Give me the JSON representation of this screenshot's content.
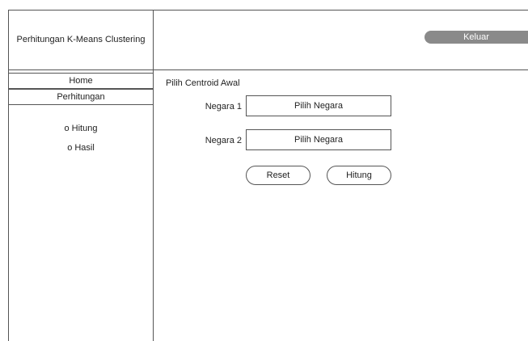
{
  "header": {
    "app_title": "Perhitungan K-Means Clustering",
    "logout_label": "Keluar"
  },
  "sidebar": {
    "items": [
      {
        "label": "Home"
      },
      {
        "label": "Perhitungan"
      }
    ],
    "sub_items": [
      {
        "label": "o Hitung"
      },
      {
        "label": "o Hasil"
      }
    ]
  },
  "main": {
    "section_title": "Pilih Centroid Awal",
    "fields": [
      {
        "label": "Negara 1",
        "value": "Pilih Negara"
      },
      {
        "label": "Negara 2",
        "value": "Pilih Negara"
      }
    ],
    "buttons": {
      "reset": "Reset",
      "hitung": "Hitung"
    }
  },
  "colors": {
    "logout_bg": "#8a8a8a",
    "border": "#555555"
  }
}
